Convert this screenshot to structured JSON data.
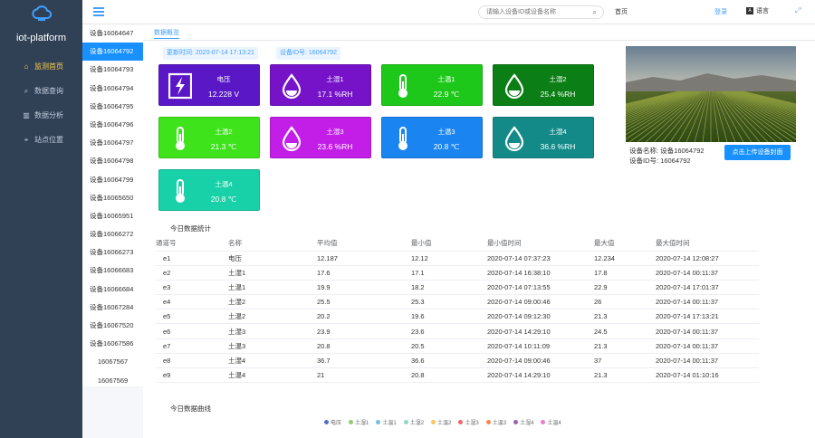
{
  "app": {
    "brand": "iot-platform"
  },
  "sidebar": {
    "items": [
      {
        "label": "监测首页",
        "icon": "home-icon",
        "active": true
      },
      {
        "label": "数据查询",
        "icon": "search-icon",
        "active": false
      },
      {
        "label": "数据分析",
        "icon": "bar-chart-icon",
        "active": false
      },
      {
        "label": "站点位置",
        "icon": "location-pin-icon",
        "active": false
      }
    ]
  },
  "topbar": {
    "search_placeholder": "请输入设备ID或设备名称",
    "home": "首页",
    "login": "登录",
    "lang": "语言"
  },
  "devices": [
    "设备16064647",
    "设备16064792",
    "设备16064793",
    "设备16064794",
    "设备16064795",
    "设备16064796",
    "设备16064797",
    "设备16064798",
    "设备16064799",
    "设备16065650",
    "设备16065951",
    "设备16066272",
    "设备16066273",
    "设备16066683",
    "设备16066684",
    "设备16067284",
    "设备16067520",
    "设备16067586",
    "16067567",
    "16067569"
  ],
  "main": {
    "tab": "数据概览",
    "update_time": "更新时间: 2020-07-14 17:13:21",
    "device_id": "设备ID号: 16064792",
    "cards": [
      {
        "name": "电压",
        "value": "12.228 V",
        "color": "#5a17c6",
        "icon": "bolt-icon"
      },
      {
        "name": "土湿1",
        "value": "17.1 %RH",
        "color": "#7613c9",
        "icon": "drop-icon"
      },
      {
        "name": "土温1",
        "value": "22.9 ℃",
        "color": "#1ec81a",
        "icon": "thermometer-icon"
      },
      {
        "name": "土湿2",
        "value": "25.4 %RH",
        "color": "#0b7f15",
        "icon": "drop-icon"
      },
      {
        "name": "土温2",
        "value": "21.3 ℃",
        "color": "#3ee31c",
        "icon": "thermometer-icon"
      },
      {
        "name": "土湿3",
        "value": "23.6 %RH",
        "color": "#c21ee8",
        "icon": "drop-icon"
      },
      {
        "name": "土温3",
        "value": "20.8 ℃",
        "color": "#1a84f0",
        "icon": "thermometer-icon"
      },
      {
        "name": "土湿4",
        "value": "36.6 %RH",
        "color": "#138a88",
        "icon": "drop-icon"
      },
      {
        "name": "土温4",
        "value": "20.8 ℃",
        "color": "#18d1a8",
        "icon": "thermometer-icon"
      }
    ],
    "device_name": "设备名称: 设备16064792",
    "device_id2": "设备ID号: 16064792",
    "upload_button": "点击上传设备封面",
    "stats_title": "今日数据统计",
    "stats_headers": [
      "通道号",
      "名称",
      "平均值",
      "最小值",
      "最小值时间",
      "最大值",
      "最大值时间"
    ],
    "stats_rows": [
      [
        "e1",
        "电压",
        "12.187",
        "12.12",
        "2020-07-14 07:37:23",
        "12.234",
        "2020-07-14 12:08:27"
      ],
      [
        "e2",
        "土湿1",
        "17.6",
        "17.1",
        "2020-07-14 16:38:10",
        "17.8",
        "2020-07-14 00:11:37"
      ],
      [
        "e3",
        "土温1",
        "19.9",
        "18.2",
        "2020-07-14 07:13:55",
        "22.9",
        "2020-07-14 17:01:37"
      ],
      [
        "e4",
        "土湿2",
        "25.5",
        "25.3",
        "2020-07-14 09:00:46",
        "26",
        "2020-07-14 00:11:37"
      ],
      [
        "e5",
        "土温2",
        "20.2",
        "19.6",
        "2020-07-14 09:12:30",
        "21.3",
        "2020-07-14 17:13:21"
      ],
      [
        "e6",
        "土湿3",
        "23.9",
        "23.6",
        "2020-07-14 14:29:10",
        "24.5",
        "2020-07-14 00:11:37"
      ],
      [
        "e7",
        "土温3",
        "20.8",
        "20.5",
        "2020-07-14 10:11:09",
        "21.3",
        "2020-07-14 00:11:37"
      ],
      [
        "e8",
        "土湿4",
        "36.7",
        "36.6",
        "2020-07-14 09:00:46",
        "37",
        "2020-07-14 00:11:37"
      ],
      [
        "e9",
        "土温4",
        "21",
        "20.8",
        "2020-07-14 14:29:10",
        "21.3",
        "2020-07-14 01:10:16"
      ]
    ],
    "curve_title": "今日数据曲线",
    "legend": [
      {
        "name": "电压",
        "color": "#5470c6"
      },
      {
        "name": "土湿1",
        "color": "#91cc75"
      },
      {
        "name": "土温1",
        "color": "#73c0de"
      },
      {
        "name": "土湿2",
        "color": "#91d5c5"
      },
      {
        "name": "土温2",
        "color": "#fac858"
      },
      {
        "name": "土湿3",
        "color": "#ee6666"
      },
      {
        "name": "土温3",
        "color": "#fc8452"
      },
      {
        "name": "土湿4",
        "color": "#9a60b4"
      },
      {
        "name": "土温4",
        "color": "#ea7ccc"
      }
    ]
  }
}
